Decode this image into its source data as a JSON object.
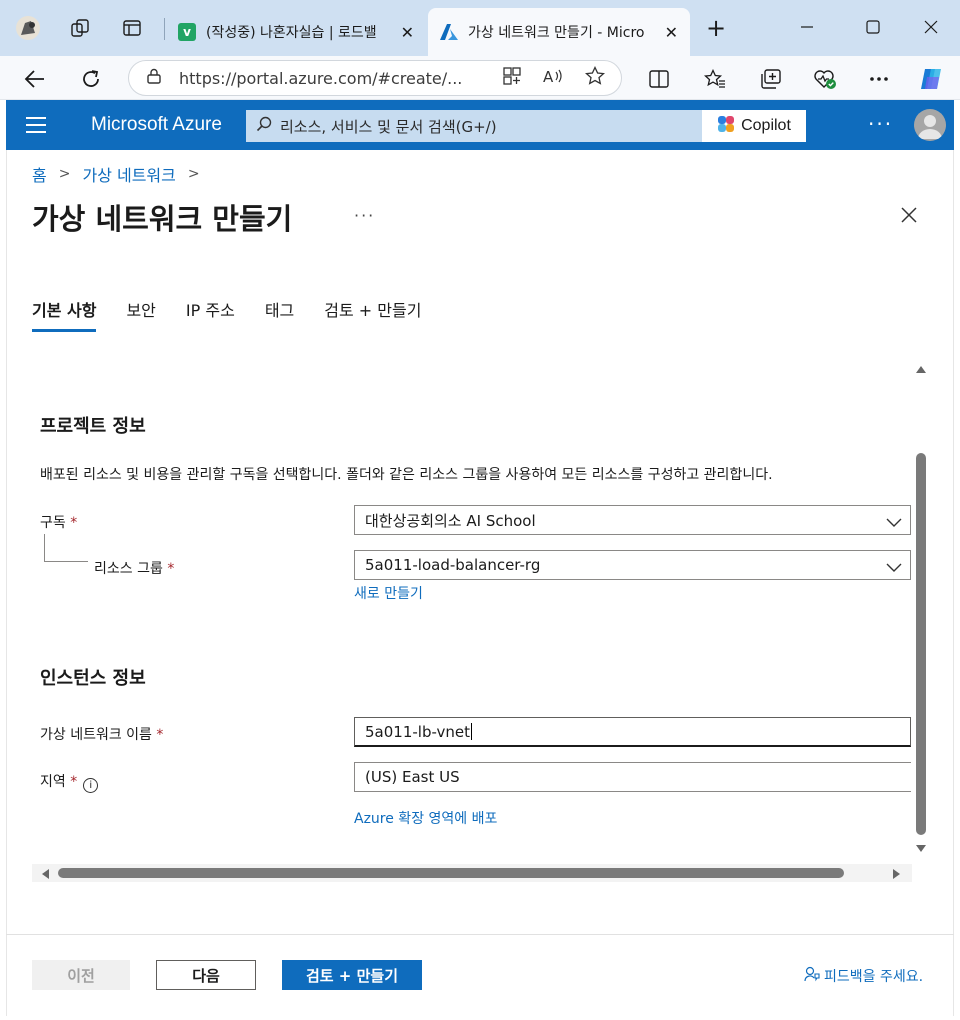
{
  "browser": {
    "tabs": [
      {
        "title": "(작성중) 나혼자실습 | 로드밸",
        "favicon": "v",
        "favicon_color": "#21a464"
      },
      {
        "title": "가상 네트워크 만들기 - Micro",
        "favicon": "A",
        "favicon_color": "#0f6cbd"
      }
    ],
    "url": "https://portal.azure.com/#create/..."
  },
  "azure": {
    "brand": "Microsoft Azure",
    "search_placeholder": "리소스, 서비스 및 문서 검색(G+/)",
    "copilot_label": "Copilot"
  },
  "breadcrumb": [
    "홈",
    "가상 네트워크"
  ],
  "page_title": "가상 네트워크 만들기",
  "tabs": [
    "기본 사항",
    "보안",
    "IP 주소",
    "태그",
    "검토 + 만들기"
  ],
  "project": {
    "heading": "프로젝트 정보",
    "description": "배포된 리소스 및 비용을 관리할 구독을 선택합니다. 폴더와 같은 리소스 그룹을 사용하여 모든 리소스를 구성하고 관리합니다.",
    "subscription_label": "구독",
    "subscription_value": "대한상공회의소 AI School",
    "rg_label": "리소스 그룹",
    "rg_value": "5a011-load-balancer-rg",
    "create_new": "새로 만들기"
  },
  "instance": {
    "heading": "인스턴스 정보",
    "vnet_name_label": "가상 네트워크 이름",
    "vnet_name_value": "5a011-lb-vnet",
    "region_label": "지역",
    "region_value": "(US) East US",
    "edge_zone_link": "Azure 확장 영역에 배포"
  },
  "footer": {
    "prev": "이전",
    "next": "다음",
    "review_create": "검토 + 만들기",
    "feedback": "피드백을 주세요."
  },
  "required_mark": "*",
  "colors": {
    "accent": "#0f6cbd",
    "required": "#a4262c"
  }
}
